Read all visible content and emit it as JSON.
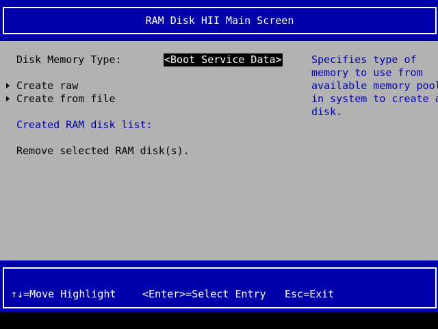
{
  "title": "RAM Disk HII Main Screen",
  "form": {
    "disk_memory_type": {
      "label": "Disk Memory Type:",
      "value": "<Boot Service Data>"
    },
    "create_raw": "Create raw",
    "create_from_file": "Create from file",
    "created_list_subtitle": "Created RAM disk list:",
    "remove_selected": "Remove selected RAM disk(s)."
  },
  "help": {
    "lines": [
      "Specifies type of",
      "memory to use from",
      "available memory pool",
      "in system to create a",
      "disk."
    ]
  },
  "footer": {
    "move_highlight": "↑↓=Move Highlight",
    "select_entry": "<Enter>=Select Entry",
    "exit": "Esc=Exit"
  },
  "colors": {
    "background": "#b2b2b2",
    "band": "#0000aa",
    "subtitle_text": "#0000aa",
    "highlight_bg": "#000000",
    "highlight_text": "#ffffff"
  }
}
